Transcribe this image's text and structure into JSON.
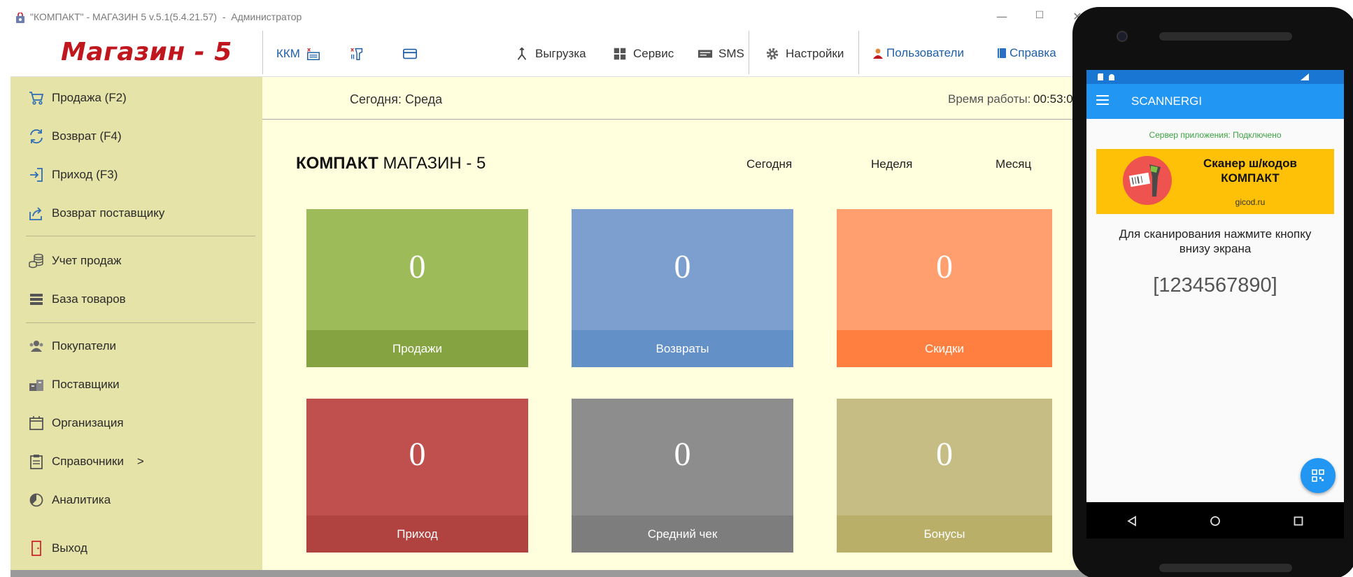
{
  "window": {
    "title": "\"КОМПАКТ\" - МАГАЗИН 5 v.5.1(5.4.21.57)  -  Администратор",
    "minimize_glyph": "—",
    "maximize_glyph": "☐",
    "close_glyph": "✕"
  },
  "toolbar": {
    "logo": "Магазин - 5",
    "kkm_label": "ККМ",
    "items": [
      {
        "label": "Выгрузка",
        "icon": "export-icon"
      },
      {
        "label": "Сервис",
        "icon": "grid-icon"
      },
      {
        "label": "SMS",
        "icon": "sms-icon"
      },
      {
        "label": "Настройки",
        "icon": "gear-icon"
      },
      {
        "label": "Пользователи",
        "icon": "user-icon"
      },
      {
        "label": "Справка",
        "icon": "book-icon"
      }
    ]
  },
  "sidebar": {
    "items": [
      {
        "label": "Продажа (F2)",
        "icon": "cart-icon"
      },
      {
        "label": "Возврат (F4)",
        "icon": "refresh-icon"
      },
      {
        "label": "Приход (F3)",
        "icon": "login-icon"
      },
      {
        "label": "Возврат поставщику",
        "icon": "share-icon"
      },
      {
        "label": "Учет продаж",
        "icon": "coins-icon"
      },
      {
        "label": "База товаров",
        "icon": "database-icon"
      },
      {
        "label": "Покупатели",
        "icon": "customers-icon"
      },
      {
        "label": "Поставщики",
        "icon": "suppliers-icon"
      },
      {
        "label": "Организация",
        "icon": "calendar-icon"
      },
      {
        "label": "Справочники    >",
        "icon": "clipboard-icon"
      },
      {
        "label": "Аналитика",
        "icon": "pie-chart-icon"
      },
      {
        "label": "Выход",
        "icon": "exit-icon"
      }
    ]
  },
  "info": {
    "today": "Сегодня: Среда",
    "work_label": "Время работы:",
    "work_time": "00:53:0"
  },
  "dashboard": {
    "brand_bold": "КОМПАКТ",
    "brand_rest": "МАГАЗИН - 5",
    "periods": [
      "Сегодня",
      "Неделя",
      "Месяц"
    ],
    "tiles": [
      {
        "value": "0",
        "label": "Продажи",
        "top": "#9dbb59",
        "bottom": "#85a341"
      },
      {
        "value": "0",
        "label": "Возвраты",
        "top": "#7c9fcf",
        "bottom": "#6390c6"
      },
      {
        "value": "0",
        "label": "Скидки",
        "top": "#ff9e6e",
        "bottom": "#ff7f40"
      },
      {
        "value": "0",
        "label": "Приход",
        "top": "#c0504d",
        "bottom": "#b04240"
      },
      {
        "value": "0",
        "label": "Средний чек",
        "top": "#8d8d8d",
        "bottom": "#7d7d7d"
      },
      {
        "value": "0",
        "label": "Бонусы",
        "top": "#c6bd85",
        "bottom": "#baaf68"
      }
    ]
  },
  "phone": {
    "app_title": "SCANNERGI",
    "server_status": "Сервер приложения: Подключено",
    "banner_title": "Сканер ш/кодов КОМПАКТ",
    "banner_site": "gicod.ru",
    "instruction": "Для сканирования нажмите кнопку внизу экрана",
    "scanned_code": "[1234567890]"
  }
}
